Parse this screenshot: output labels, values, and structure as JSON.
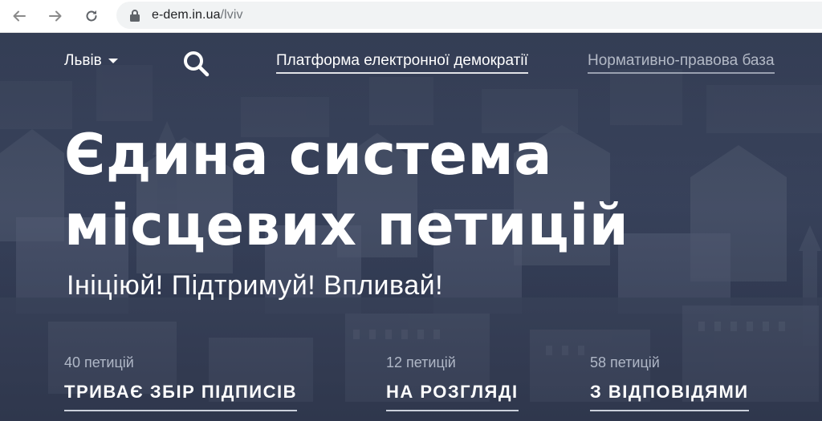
{
  "browser": {
    "url_host": "e-dem.in.ua",
    "url_path": "/lviv"
  },
  "header": {
    "city": "Львів",
    "nav_links": [
      {
        "label": "Платформа електронної демократії"
      },
      {
        "label": "Нормативно-правова база"
      }
    ]
  },
  "hero": {
    "headline_line1": "Єдина система",
    "headline_line2": "місцевих петицій",
    "tagline": "Ініціюй! Підтримуй! Впливай!"
  },
  "stats": [
    {
      "count": "40 петицій",
      "label": "ТРИВАЄ ЗБІР ПІДПИСІВ"
    },
    {
      "count": "12 петицій",
      "label": "НА РОЗГЛЯДІ"
    },
    {
      "count": "58 петицій",
      "label": "З ВІДПОВІДЯМИ"
    }
  ],
  "colors": {
    "hero_tint": "#3f4a63",
    "text_primary": "#ffffff",
    "text_muted": "#d7deeb"
  }
}
